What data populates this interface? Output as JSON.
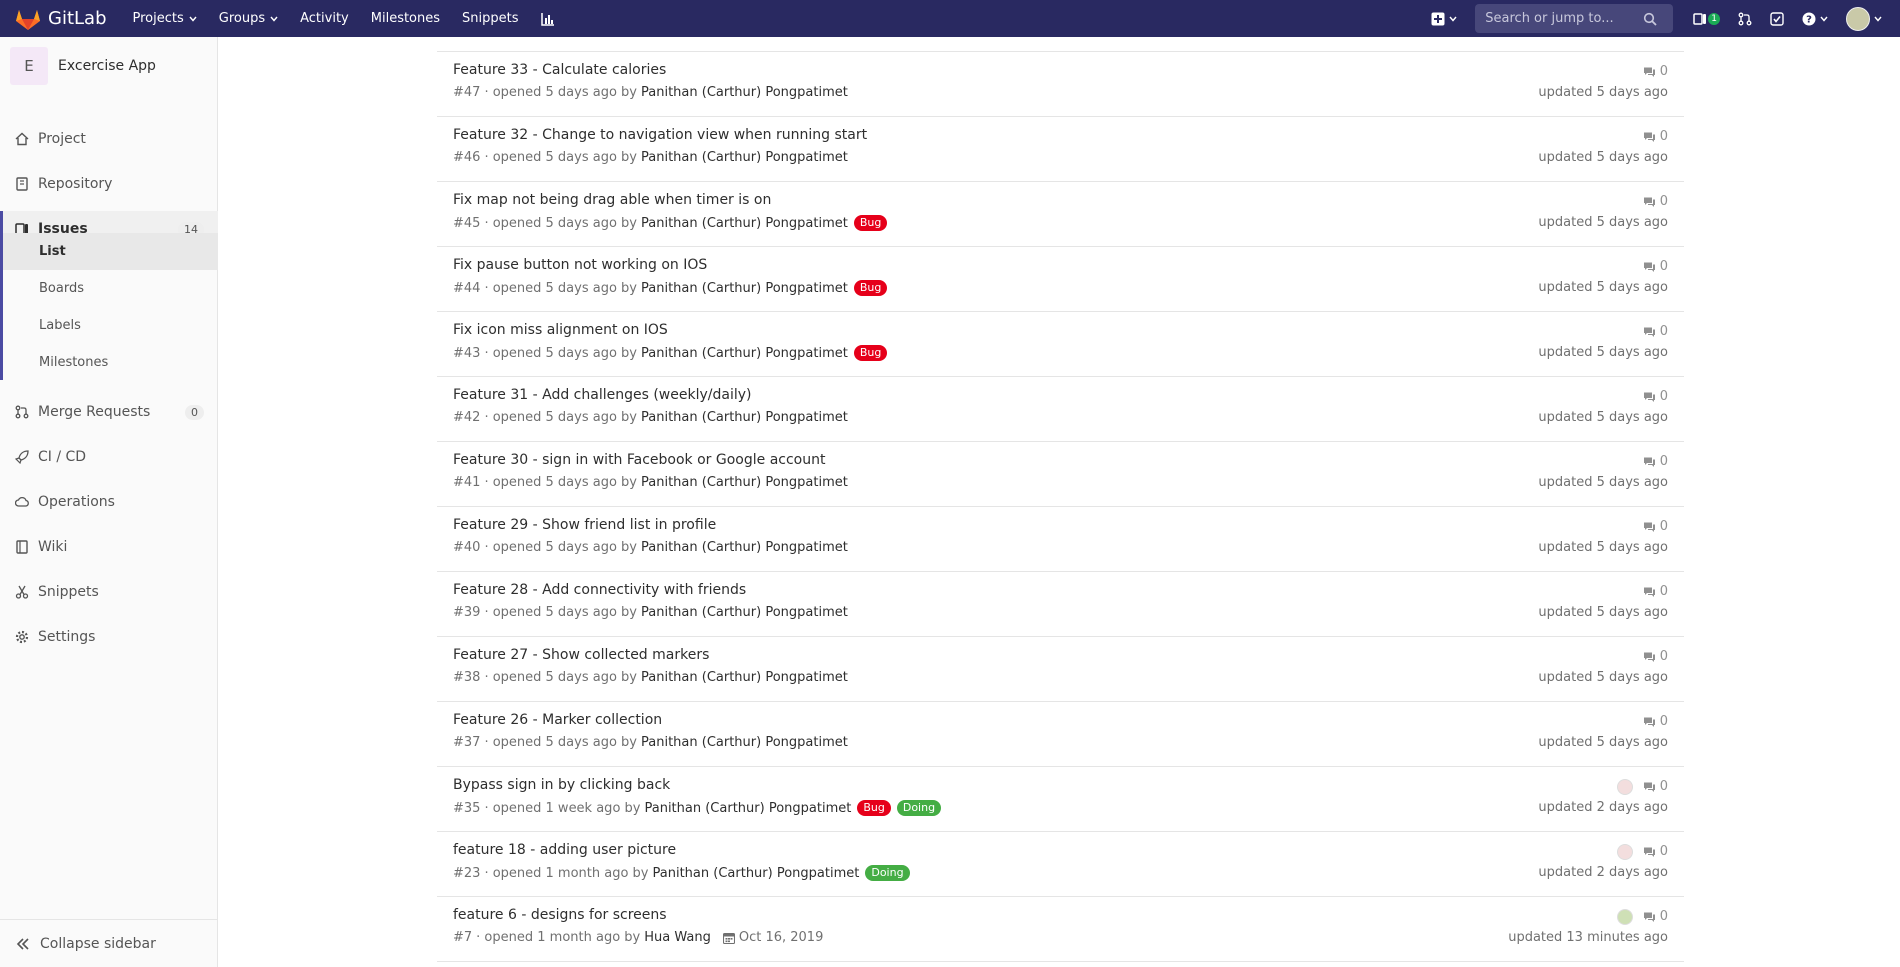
{
  "navbar": {
    "brand": "GitLab",
    "links": [
      {
        "label": "Projects",
        "dropdown": true
      },
      {
        "label": "Groups",
        "dropdown": true
      },
      {
        "label": "Activity",
        "dropdown": false
      },
      {
        "label": "Milestones",
        "dropdown": false
      },
      {
        "label": "Snippets",
        "dropdown": false
      }
    ],
    "search_placeholder": "Search or jump to...",
    "todo_count": "1",
    "colors": {
      "navbar_bg": "#292961",
      "accent": "#4b4ba3"
    }
  },
  "sidebar": {
    "project_initial": "E",
    "project_name": "Excercise App",
    "items": [
      {
        "label": "Project",
        "icon": "home-icon"
      },
      {
        "label": "Repository",
        "icon": "repository-icon"
      },
      {
        "label": "Issues",
        "icon": "issues-icon",
        "badge": "14"
      },
      {
        "label": "Merge Requests",
        "icon": "merge-request-icon",
        "badge": "0"
      },
      {
        "label": "CI / CD",
        "icon": "rocket-icon"
      },
      {
        "label": "Operations",
        "icon": "cloud-gear-icon"
      },
      {
        "label": "Wiki",
        "icon": "book-icon"
      },
      {
        "label": "Snippets",
        "icon": "scissors-icon"
      },
      {
        "label": "Settings",
        "icon": "gear-icon"
      }
    ],
    "issues_sub": [
      {
        "label": "List"
      },
      {
        "label": "Boards"
      },
      {
        "label": "Labels"
      },
      {
        "label": "Milestones"
      }
    ],
    "collapse_label": "Collapse sidebar"
  },
  "issues": [
    {
      "title": "Feature 33 - Calculate calories",
      "ref": "#47",
      "opened": "· opened 5 days ago by",
      "author": "Panithan (Carthur) Pongpatimet",
      "labels": [],
      "comments": "0",
      "updated": "updated 5 days ago"
    },
    {
      "title": "Feature 32 - Change to navigation view when running start",
      "ref": "#46",
      "opened": "· opened 5 days ago by",
      "author": "Panithan (Carthur) Pongpatimet",
      "labels": [],
      "comments": "0",
      "updated": "updated 5 days ago"
    },
    {
      "title": "Fix map not being drag able when timer is on",
      "ref": "#45",
      "opened": "· opened 5 days ago by",
      "author": "Panithan (Carthur) Pongpatimet",
      "labels": [
        "Bug"
      ],
      "comments": "0",
      "updated": "updated 5 days ago"
    },
    {
      "title": "Fix pause button not working on IOS",
      "ref": "#44",
      "opened": "· opened 5 days ago by",
      "author": "Panithan (Carthur) Pongpatimet",
      "labels": [
        "Bug"
      ],
      "comments": "0",
      "updated": "updated 5 days ago"
    },
    {
      "title": "Fix icon miss alignment on IOS",
      "ref": "#43",
      "opened": "· opened 5 days ago by",
      "author": "Panithan (Carthur) Pongpatimet",
      "labels": [
        "Bug"
      ],
      "comments": "0",
      "updated": "updated 5 days ago"
    },
    {
      "title": "Feature 31 - Add challenges (weekly/daily)",
      "ref": "#42",
      "opened": "· opened 5 days ago by",
      "author": "Panithan (Carthur) Pongpatimet",
      "labels": [],
      "comments": "0",
      "updated": "updated 5 days ago"
    },
    {
      "title": "Feature 30 - sign in with Facebook or Google account",
      "ref": "#41",
      "opened": "· opened 5 days ago by",
      "author": "Panithan (Carthur) Pongpatimet",
      "labels": [],
      "comments": "0",
      "updated": "updated 5 days ago"
    },
    {
      "title": "Feature 29 - Show friend list in profile",
      "ref": "#40",
      "opened": "· opened 5 days ago by",
      "author": "Panithan (Carthur) Pongpatimet",
      "labels": [],
      "comments": "0",
      "updated": "updated 5 days ago"
    },
    {
      "title": "Feature 28 - Add connectivity with friends",
      "ref": "#39",
      "opened": "· opened 5 days ago by",
      "author": "Panithan (Carthur) Pongpatimet",
      "labels": [],
      "comments": "0",
      "updated": "updated 5 days ago"
    },
    {
      "title": "Feature 27 - Show collected markers",
      "ref": "#38",
      "opened": "· opened 5 days ago by",
      "author": "Panithan (Carthur) Pongpatimet",
      "labels": [],
      "comments": "0",
      "updated": "updated 5 days ago"
    },
    {
      "title": "Feature 26 - Marker collection",
      "ref": "#37",
      "opened": "· opened 5 days ago by",
      "author": "Panithan (Carthur) Pongpatimet",
      "labels": [],
      "comments": "0",
      "updated": "updated 5 days ago"
    },
    {
      "title": "Bypass sign in by clicking back",
      "ref": "#35",
      "opened": "· opened 1 week ago by",
      "author": "Panithan (Carthur) Pongpatimet",
      "labels": [
        "Bug",
        "Doing"
      ],
      "comments": "0",
      "updated": "updated 2 days ago",
      "assignee": "a1"
    },
    {
      "title": "feature 18 - adding user picture",
      "ref": "#23",
      "opened": "· opened 1 month ago by",
      "author": "Panithan (Carthur) Pongpatimet",
      "labels": [
        "Doing"
      ],
      "comments": "0",
      "updated": "updated 2 days ago",
      "assignee": "a1"
    },
    {
      "title": "feature 6 - designs for screens",
      "ref": "#7",
      "opened": "· opened 1 month ago by",
      "author": "Hua Wang",
      "labels": [],
      "due": "Oct 16, 2019",
      "comments": "0",
      "updated": "updated 13 minutes ago",
      "assignee": "a2"
    }
  ]
}
